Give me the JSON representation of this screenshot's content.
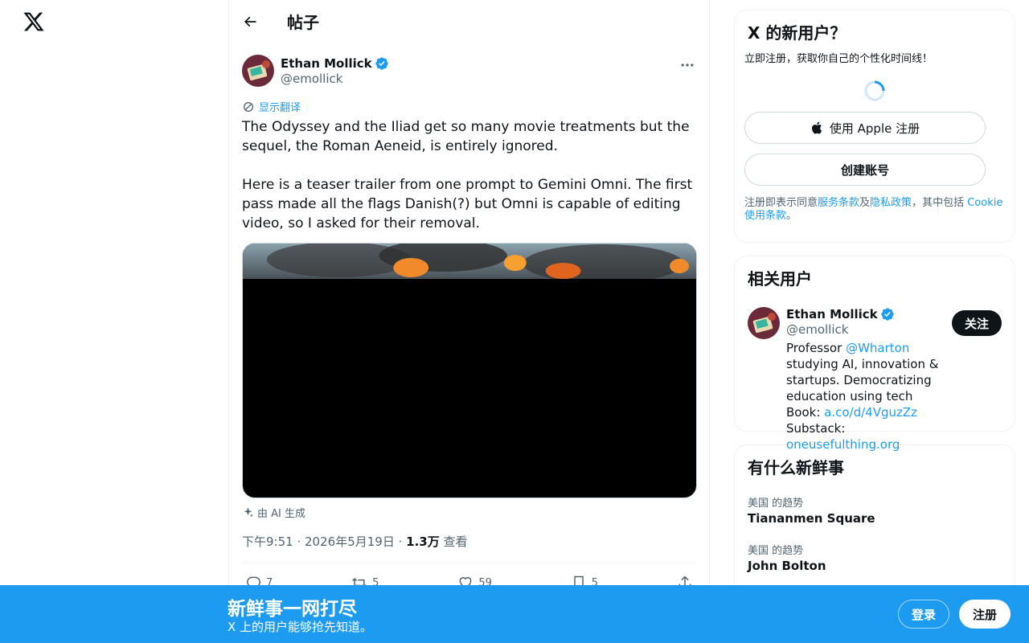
{
  "nav": {
    "logo_icon": "x-logo"
  },
  "header": {
    "back_icon": "arrow-left",
    "title": "帖子"
  },
  "post": {
    "author_name": "Ethan Mollick",
    "handle": "@emollick",
    "verified": true,
    "translate_label": "显示翻译",
    "text": "The Odyssey and the Iliad get so many movie treatments but the sequel, the Roman Aeneid, is entirely ignored.\n\nHere is a teaser trailer from one prompt to Gemini Omni. The first pass made all the flags Danish(?) but Omni is capable of editing video, so I asked for their removal.",
    "ai_label": "由 AI 生成",
    "time": "下午9:51",
    "date": "2026年5月19日",
    "views_count": "1.3万",
    "views_label": "查看",
    "replies": "7",
    "reposts": "5",
    "likes": "59",
    "bookmarks": "5"
  },
  "signup": {
    "title": "X 的新用户？",
    "subtitle": "立即注册，获取你自己的个性化时间线！",
    "apple_label": "使用 Apple 注册",
    "create_label": "创建账号",
    "terms_prefix": "注册即表示同意",
    "terms_link": "服务条款",
    "and": "及",
    "privacy_link": "隐私政策",
    "terms_middle": "，其中包括 ",
    "cookie_link": "Cookie 使用条款",
    "terms_end": "。"
  },
  "related": {
    "title": "相关用户",
    "name": "Ethan Mollick",
    "handle": "@emollick",
    "follow_label": "关注",
    "bio_1": "Professor ",
    "bio_link_1": "@Wharton",
    "bio_2": " studying AI, innovation & startups. Democratizing education using tech Book: ",
    "bio_link_2": "a.co/d/4VguzZz",
    "bio_3": " Substack: ",
    "bio_link_3": "oneusefulthing.org"
  },
  "trends": {
    "title": "有什么新鲜事",
    "items": [
      {
        "meta": "美国 的趋势",
        "name": "Tiananmen Square"
      },
      {
        "meta": "美国 的趋势",
        "name": "John Bolton"
      }
    ]
  },
  "banner": {
    "title": "新鲜事一网打尽",
    "subtitle": "X 上的用户能够抢先知道。",
    "login_label": "登录",
    "register_label": "注册"
  },
  "colors": {
    "accent": "#1d9bf0",
    "text": "#0f1419",
    "muted": "#536471"
  }
}
